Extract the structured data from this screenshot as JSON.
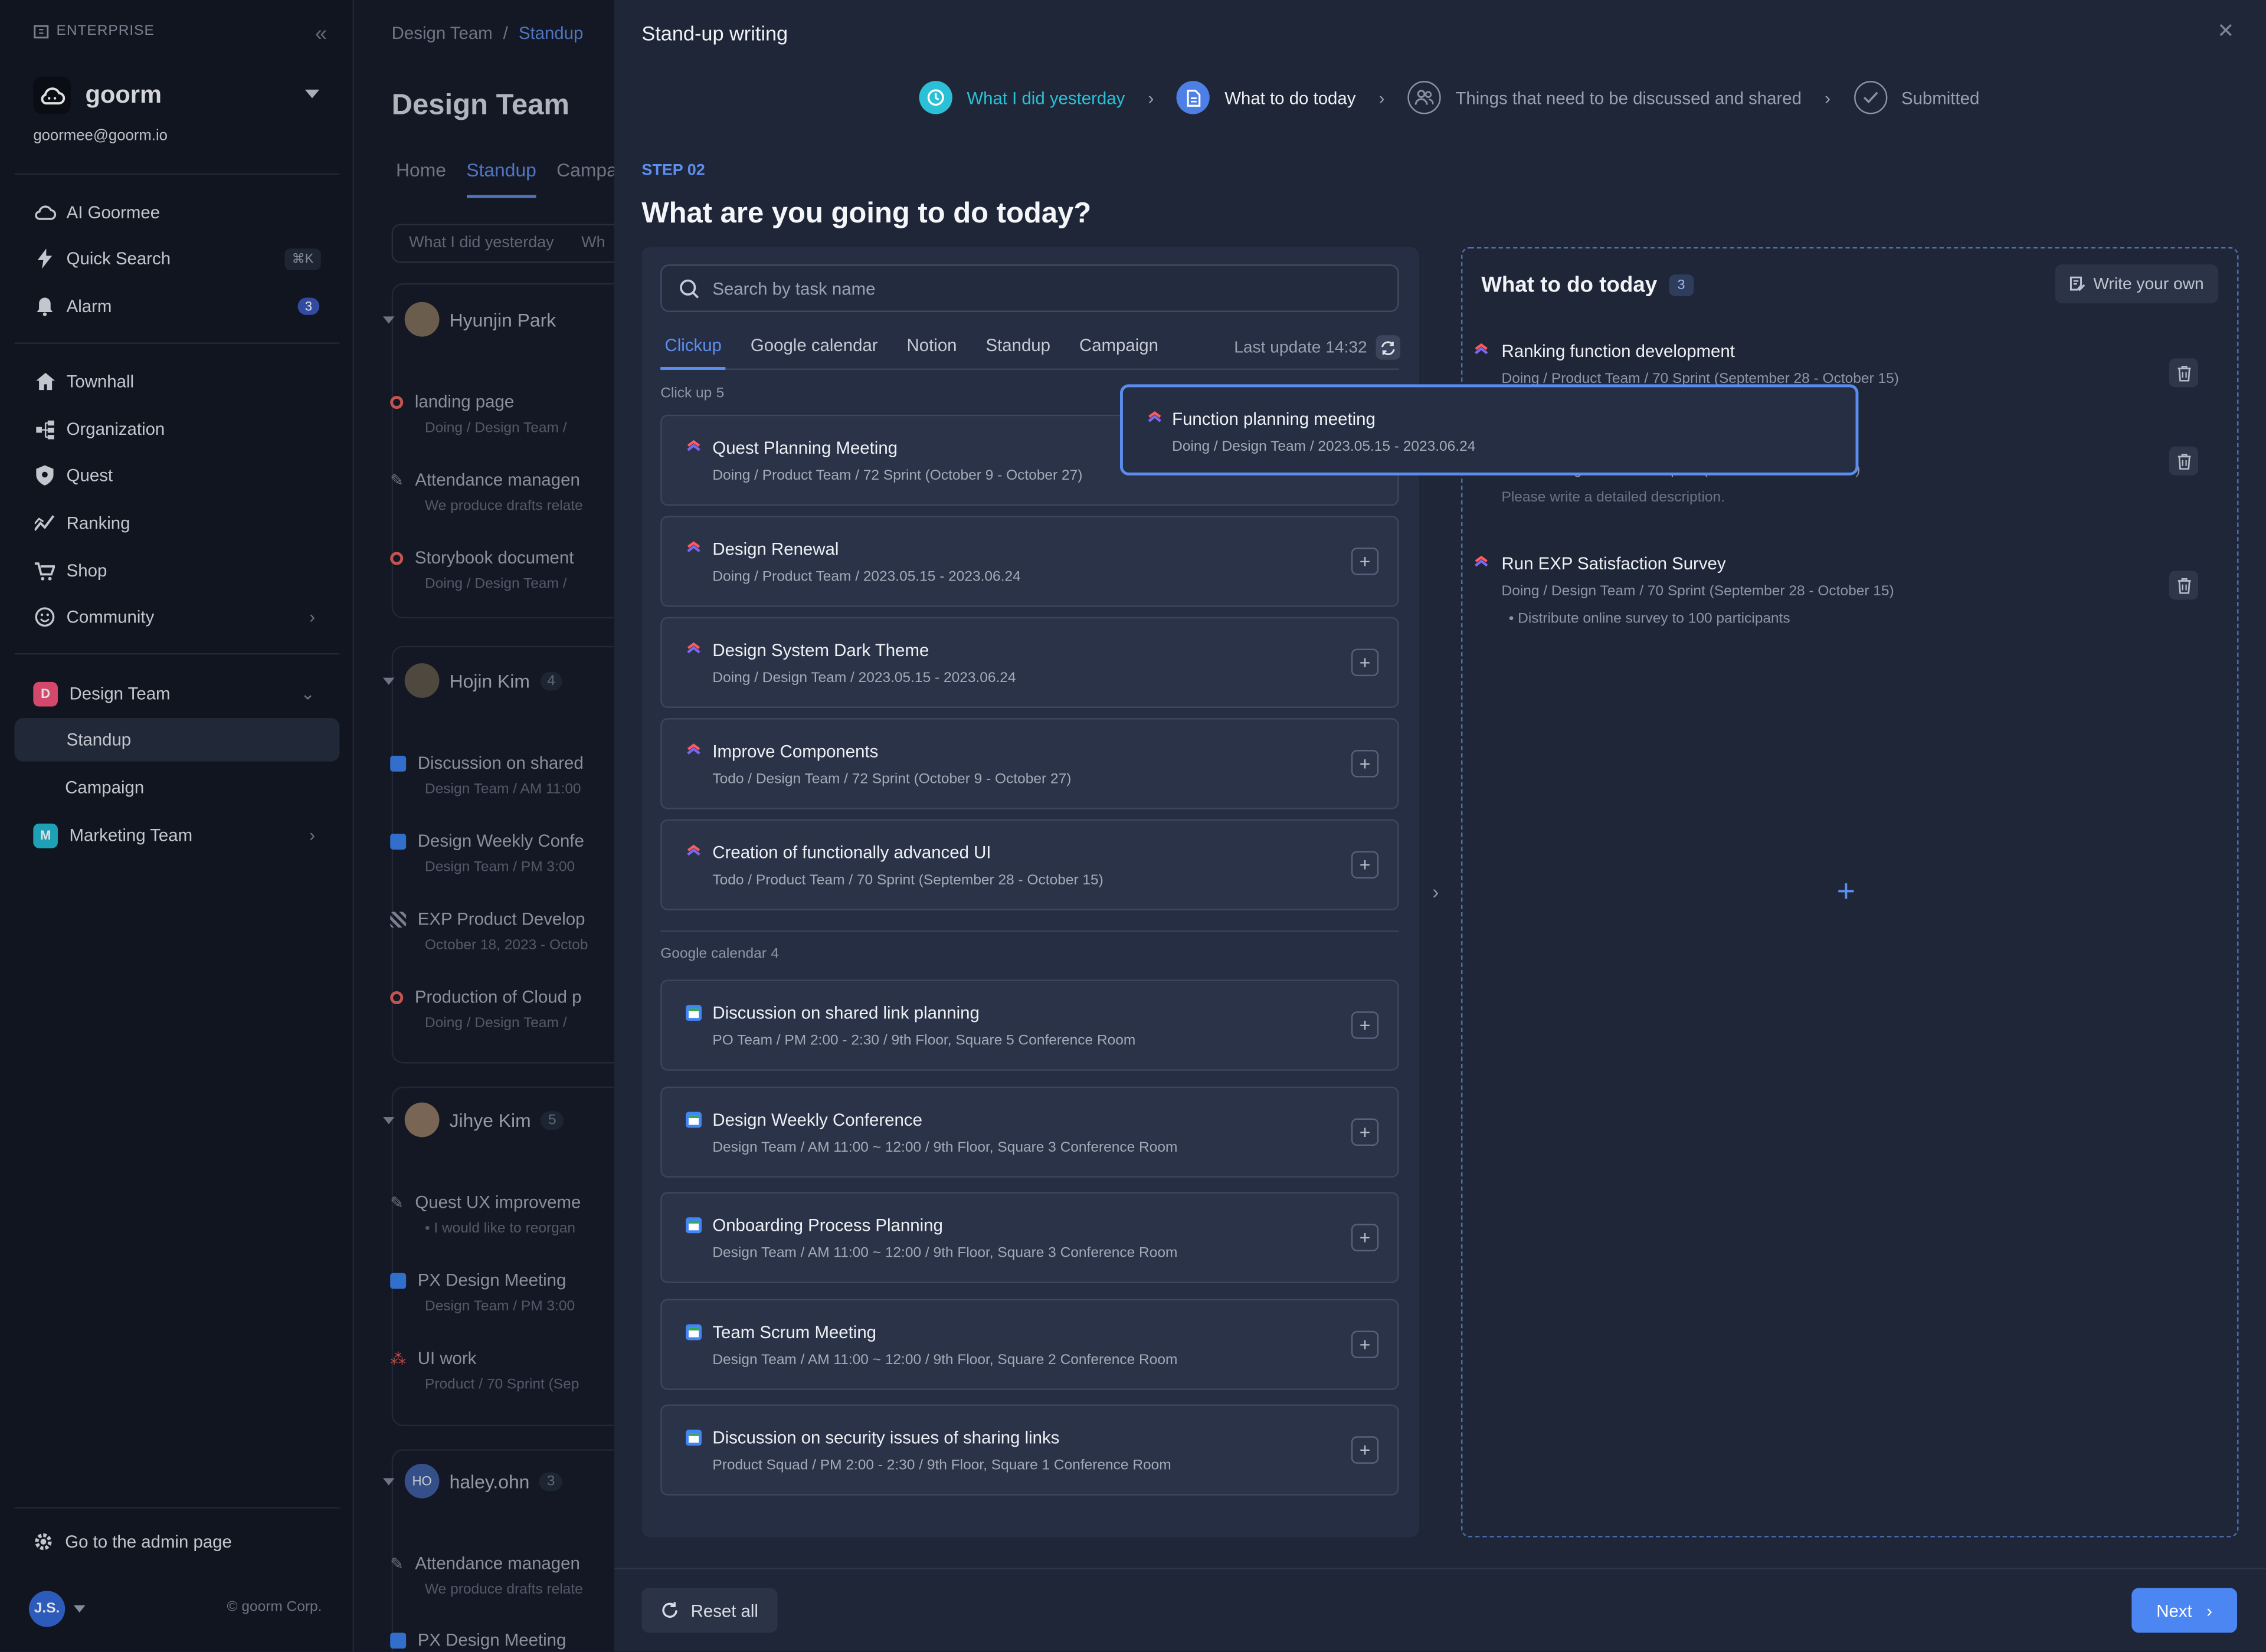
{
  "sidebar": {
    "enterprise_label": "ENTERPRISE",
    "org_name": "goorm",
    "email": "goormee@goorm.io",
    "nav": [
      {
        "label": "AI Goormee"
      },
      {
        "label": "Quick Search",
        "shortcut": "⌘K"
      },
      {
        "label": "Alarm",
        "badge": "3"
      },
      {
        "label": "Townhall"
      },
      {
        "label": "Organization"
      },
      {
        "label": "Quest"
      },
      {
        "label": "Ranking"
      },
      {
        "label": "Shop"
      },
      {
        "label": "Community"
      }
    ],
    "teams": [
      {
        "badge": "D",
        "label": "Design Team",
        "color": "#f2547a"
      },
      {
        "badge": "M",
        "label": "Marketing Team",
        "color": "#23b8d1"
      }
    ],
    "team_sub": [
      "Standup",
      "Campaign"
    ],
    "admin_label": "Go to the admin page",
    "avatar": "J.S.",
    "corp": "© goorm Corp."
  },
  "background": {
    "crumb_root": "Design Team",
    "crumb_sep": "/",
    "crumb_current": "Standup",
    "title": "Design Team",
    "tabs": [
      "Home",
      "Standup",
      "Campaign"
    ],
    "chip": "What I did yesterday",
    "chip2": "Wh",
    "people": [
      {
        "name": "Hyunjin Park",
        "count": ""
      },
      {
        "name": "Hojin Kim",
        "count": "4"
      },
      {
        "name": "Jihye Kim",
        "count": "5"
      },
      {
        "name": "haley.ohn",
        "count": "3",
        "initials": "HO"
      }
    ],
    "items": [
      {
        "title": "landing page",
        "meta": "Doing  /  Design Team  /"
      },
      {
        "title": "Attendance managen",
        "meta": "We produce drafts relate"
      },
      {
        "title": "Storybook document",
        "meta": "Doing  /  Design Team  /"
      },
      {
        "title": "Discussion on shared",
        "meta": "Design Team  /  AM 11:00"
      },
      {
        "title": "Design Weekly Confe",
        "meta": "Design Team  /  PM 3:00"
      },
      {
        "title": "EXP Product Develop",
        "meta": "October 18, 2023 - Octob"
      },
      {
        "title": "Production of Cloud p",
        "meta": "Doing  /  Design Team  /"
      },
      {
        "title": "Quest UX improveme",
        "meta": "•  I would like to reorgan"
      },
      {
        "title": "PX Design Meeting",
        "meta": "Design Team  /  PM 3:00"
      },
      {
        "title": "UI work",
        "meta": "Product  /  70 Sprint (Sep"
      },
      {
        "title": "Attendance managen",
        "meta": "We produce drafts relate"
      },
      {
        "title": "PX Design Meeting",
        "meta": ""
      }
    ]
  },
  "drawer": {
    "title": "Stand-up writing",
    "steps": [
      "What I did yesterday",
      "What to do today",
      "Things that need to be discussed and shared",
      "Submitted"
    ],
    "step_label": "STEP 02",
    "question": "What are you going to do today?",
    "search_placeholder": "Search by task name",
    "tabs": [
      "Clickup",
      "Google calendar",
      "Notion",
      "Standup",
      "Campaign"
    ],
    "last_update": "Last update 14:32",
    "clickup_group": {
      "label": "Click up",
      "count": "5"
    },
    "clickup_items": [
      {
        "title": "Quest Planning Meeting",
        "meta": "Doing  /  Product Team  /  72 Sprint (October 9 - October 27)"
      },
      {
        "title": "Design Renewal",
        "meta": "Doing  /  Product Team  /  2023.05.15 - 2023.06.24"
      },
      {
        "title": "Design System Dark Theme",
        "meta": "Doing  /  Design Team  /  2023.05.15 - 2023.06.24"
      },
      {
        "title": "Improve Components",
        "meta": "Todo  /  Design Team  /  72 Sprint (October 9 - October 27)"
      },
      {
        "title": "Creation of functionally advanced UI",
        "meta": "Todo  /  Product Team  /  70 Sprint (September 28 - October 15)"
      }
    ],
    "gcal_group": {
      "label": "Google calendar",
      "count": "4"
    },
    "gcal_items": [
      {
        "title": "Discussion on shared link planning",
        "meta": "PO Team  /  PM 2:00 - 2:30  /  9th Floor, Square 5 Conference Room"
      },
      {
        "title": "Design Weekly Conference",
        "meta": "Design Team  /  AM 11:00 ~ 12:00  /  9th Floor, Square 3 Conference Room"
      },
      {
        "title": "Onboarding Process Planning",
        "meta": "Design Team  /  AM 11:00 ~ 12:00  /  9th Floor, Square 3 Conference Room"
      },
      {
        "title": "Team Scrum Meeting",
        "meta": "Design Team  /  AM 11:00 ~ 12:00  /  9th Floor, Square 2 Conference Room"
      },
      {
        "title": "Discussion on security issues of sharing links",
        "meta": "Product Squad  /  PM 2:00 - 2:30  /  9th Floor, Square 1 Conference Room"
      }
    ],
    "dragging": {
      "title": "Function planning meeting",
      "meta": "Doing  /  Design Team  /  2023.05.15 - 2023.06.24"
    },
    "today": {
      "title": "What to do today",
      "count": "3",
      "write_own": "Write your own",
      "items": [
        {
          "title": "Ranking function development",
          "meta": "Doing  /  Product Team  /  70 Sprint (September 28 - October 15)",
          "desc": ""
        },
        {
          "title": "",
          "meta": "Todo  /  Design Team  /  72 Sprint (October 9 - October 27)",
          "desc": "Please write a detailed description."
        },
        {
          "title": "Run EXP Satisfaction Survey",
          "meta": "Doing  /  Design Team  /  70 Sprint (September 28 - October 15)",
          "desc": "•  Distribute online survey to 100 participants"
        }
      ]
    },
    "reset_label": "Reset all",
    "next_label": "Next"
  },
  "colors": {
    "accent": "#4b86f2",
    "done": "#2bc0d6",
    "clickup": "#7b68ee",
    "gcal": "#4285f4"
  }
}
